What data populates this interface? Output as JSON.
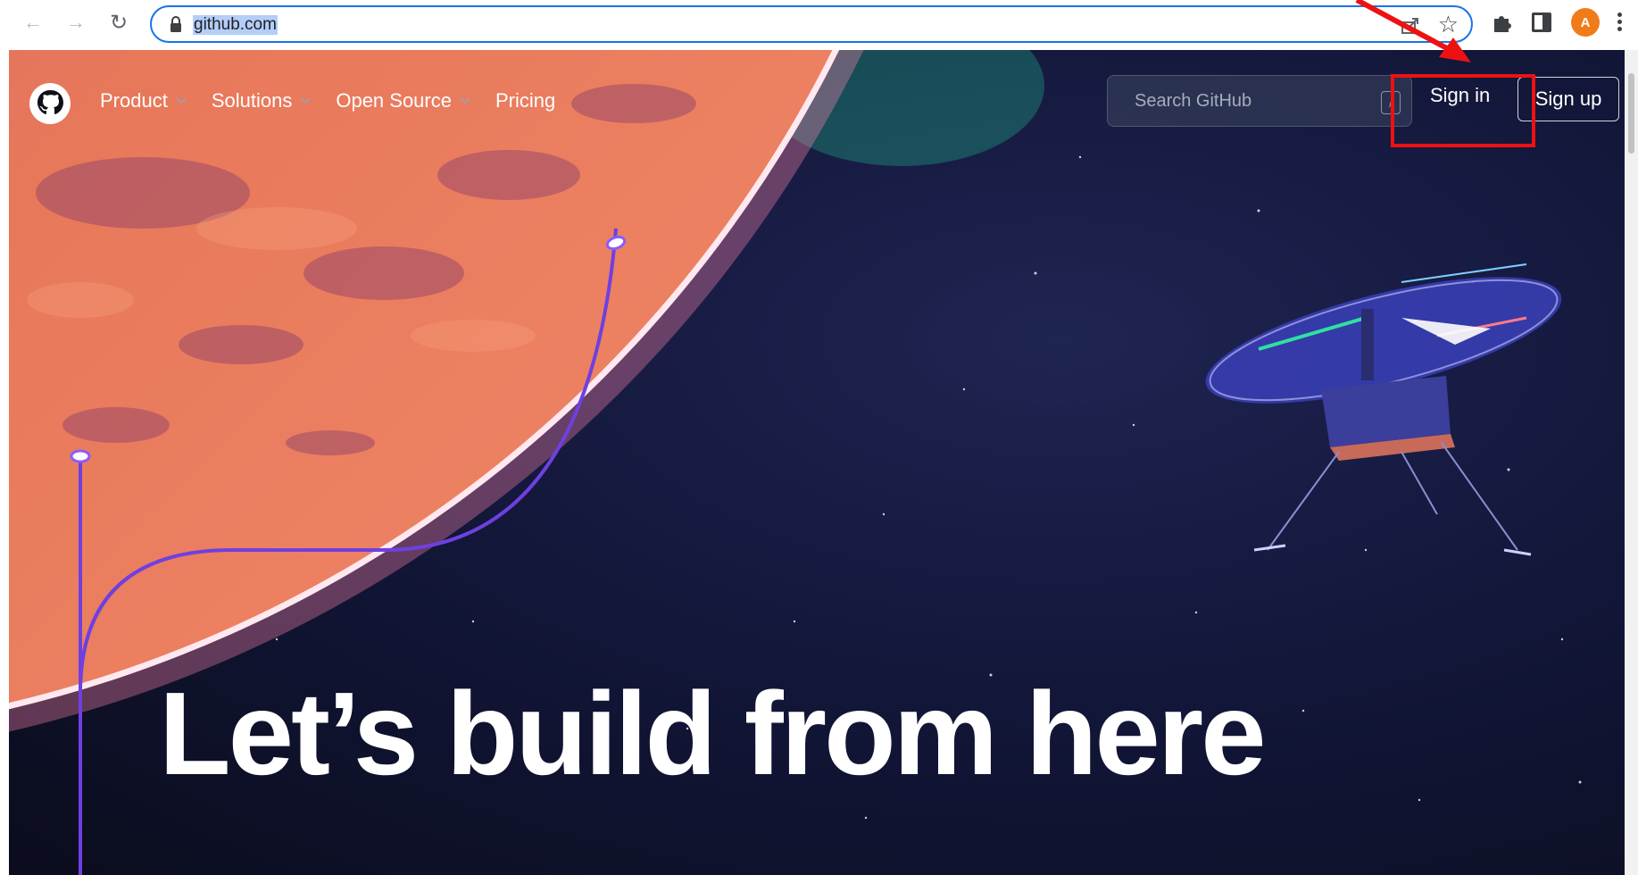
{
  "browser": {
    "url": "github.com",
    "profile_initial": "A",
    "icons": {
      "back": "arrow-left-icon",
      "forward": "arrow-right-icon",
      "reload": "reload-icon",
      "lock": "lock-icon",
      "share": "share-icon",
      "bookmark": "star-icon",
      "extensions": "puzzle-icon",
      "side_panel": "side-panel-icon",
      "menu": "kebab-menu-icon"
    },
    "accent_color": "#1a73e8",
    "avatar_color": "#f07c19"
  },
  "github": {
    "nav": [
      {
        "label": "Product",
        "has_dropdown": true
      },
      {
        "label": "Solutions",
        "has_dropdown": true
      },
      {
        "label": "Open Source",
        "has_dropdown": true
      },
      {
        "label": "Pricing",
        "has_dropdown": false
      }
    ],
    "search_placeholder": "Search GitHub",
    "search_shortcut": "/",
    "signin_label": "Sign in",
    "signup_label": "Sign up",
    "hero_title": "Let’s build from here"
  },
  "annotation": {
    "highlight_color": "#ee1111"
  }
}
